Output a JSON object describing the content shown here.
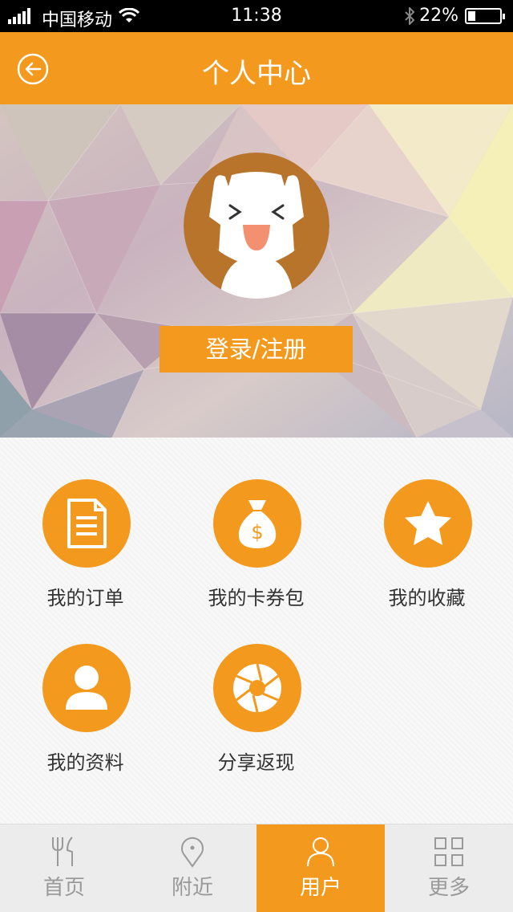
{
  "status_bar": {
    "carrier": "中国移动",
    "time": "11:38",
    "battery": "22%"
  },
  "nav": {
    "title": "个人中心"
  },
  "hero": {
    "login_label": "登录/注册"
  },
  "menu": [
    {
      "label": "我的订单",
      "icon": "document-icon"
    },
    {
      "label": "我的卡券包",
      "icon": "money-bag-icon"
    },
    {
      "label": "我的收藏",
      "icon": "star-icon"
    },
    {
      "label": "我的资料",
      "icon": "person-icon"
    },
    {
      "label": "分享返现",
      "icon": "aperture-icon"
    }
  ],
  "tabs": [
    {
      "label": "首页",
      "icon": "fork-knife-icon",
      "active": false
    },
    {
      "label": "附近",
      "icon": "location-pin-icon",
      "active": false
    },
    {
      "label": "用户",
      "icon": "user-icon",
      "active": true
    },
    {
      "label": "更多",
      "icon": "grid-icon",
      "active": false
    }
  ],
  "colors": {
    "accent": "#f39a1e",
    "status_bar": "#000000",
    "tabbar": "#ececec"
  }
}
